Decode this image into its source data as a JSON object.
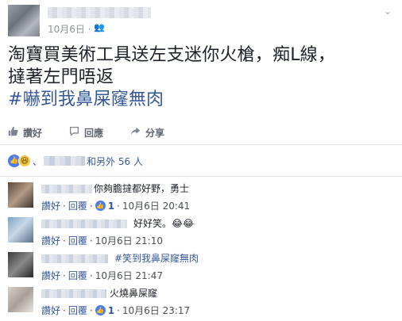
{
  "post": {
    "date": "10月6日 ·",
    "privacy_icon": "friends-icon",
    "body_line1": "淘寶買美術工具送左支迷你火槍，痴L線，",
    "body_line2": "撻著左門唔返",
    "hashtag": "#嚇到我鼻屎窿無肉"
  },
  "actions": {
    "like_label": "讚好",
    "comment_label": "回應",
    "share_label": "分享"
  },
  "reactions": {
    "separator": "、",
    "others_text": "和另外 56 人"
  },
  "comments": [
    {
      "text": "你夠膽撻都好野，勇士",
      "like_label": "讚好",
      "reply_label": "回覆",
      "likes": "1",
      "timestamp": "10月6日 20:41"
    },
    {
      "text": "好好笑。😂😂",
      "like_label": "讚好",
      "reply_label": "回覆",
      "timestamp": "10月6日 21:10"
    },
    {
      "text": "#笑到我鼻屎窿無肉",
      "like_label": "讚好",
      "reply_label": "回覆",
      "timestamp": "10月6日 21:47"
    },
    {
      "text": "火燒鼻屎窿",
      "like_label": "讚好",
      "reply_label": "回覆",
      "likes": "1",
      "timestamp": "10月6日 23:17"
    }
  ],
  "colors": {
    "link": "#365899",
    "like_blue": "#4b7cf2",
    "meta_gray": "#90949c"
  }
}
